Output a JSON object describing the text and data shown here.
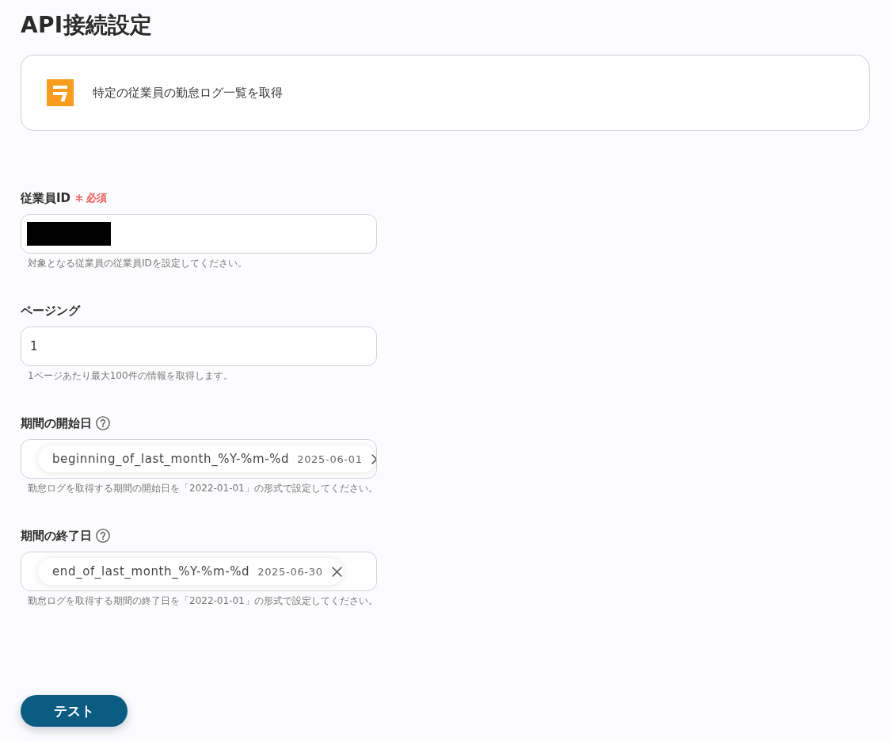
{
  "title": "API接続設定",
  "action": {
    "label": "特定の従業員の勤怠ログ一覧を取得"
  },
  "fields": [
    {
      "kind": "text",
      "label": "従業員ID",
      "required": true,
      "required_label": "必須",
      "help": false,
      "value_redacted": true,
      "hint": "対象となる従業員の従業員IDを設定してください。"
    },
    {
      "kind": "text",
      "label": "ページング",
      "required": false,
      "help": false,
      "value": "1",
      "hint": "1ページあたり最大100件の情報を取得します。"
    },
    {
      "kind": "variable",
      "label": "期間の開始日",
      "required": false,
      "help": true,
      "variable": {
        "name": "beginning_of_last_month_%Y-%m-%d",
        "preview": "2025-06-01"
      },
      "hint": "勤怠ログを取得する期間の開始日を「2022-01-01」の形式で設定してください。"
    },
    {
      "kind": "variable",
      "label": "期間の終了日",
      "required": false,
      "help": true,
      "variable": {
        "name": "end_of_last_month_%Y-%m-%d",
        "preview": "2025-06-30"
      },
      "hint": "勤怠ログを取得する期間の終了日を「2022-01-01」の形式で設定してください。"
    }
  ],
  "buttons": [
    {
      "label": "テスト"
    }
  ]
}
